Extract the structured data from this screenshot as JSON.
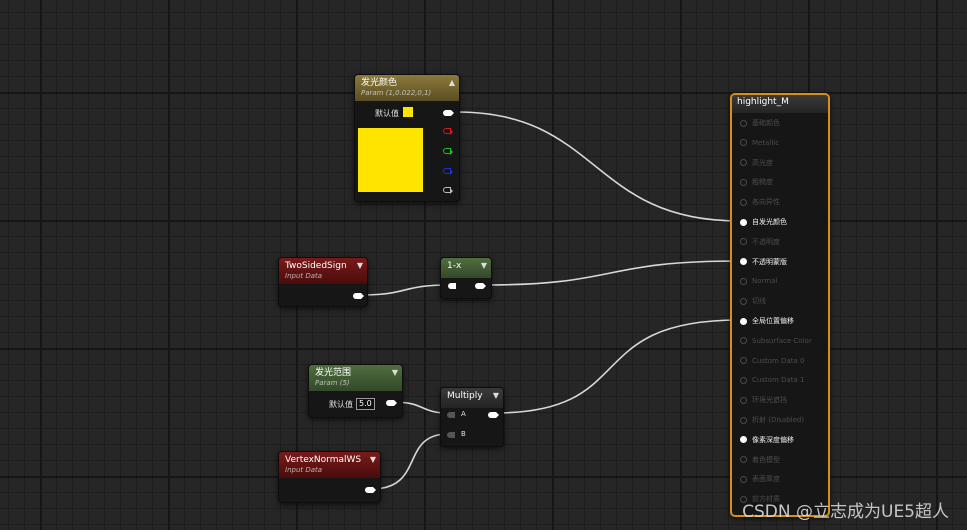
{
  "nodes": {
    "emissive_param": {
      "title": "发光颜色",
      "subtitle": "Param (1,0.022,0,1)",
      "default_label": "默认值",
      "swatch_color": "#ffe400"
    },
    "two_sided_sign": {
      "title": "TwoSidedSign",
      "subtitle": "Input Data"
    },
    "one_minus": {
      "title": "1-x"
    },
    "range_param": {
      "title": "发光范围",
      "subtitle": "Param (5)",
      "default_label": "默认值",
      "default_value": "5.0"
    },
    "multiply": {
      "title": "Multiply",
      "pin_a": "A",
      "pin_b": "B"
    },
    "vertex_normal": {
      "title": "VertexNormalWS",
      "subtitle": "Input Data"
    },
    "result": {
      "title": "highlight_M",
      "pins": [
        {
          "label": "基础颜色",
          "active": false
        },
        {
          "label": "Metallic",
          "active": false
        },
        {
          "label": "高光度",
          "active": false
        },
        {
          "label": "粗糙度",
          "active": false
        },
        {
          "label": "各向异性",
          "active": false
        },
        {
          "label": "自发光颜色",
          "active": true
        },
        {
          "label": "不透明度",
          "active": false
        },
        {
          "label": "不透明蒙版",
          "active": true
        },
        {
          "label": "Normal",
          "active": false
        },
        {
          "label": "切线",
          "active": false
        },
        {
          "label": "全局位置偏移",
          "active": true
        },
        {
          "label": "Subsurface Color",
          "active": false
        },
        {
          "label": "Custom Data 0",
          "active": false
        },
        {
          "label": "Custom Data 1",
          "active": false
        },
        {
          "label": "环境光遮挡",
          "active": false
        },
        {
          "label": "折射 (Disabled)",
          "active": false
        },
        {
          "label": "像素深度偏移",
          "active": true
        },
        {
          "label": "着色模型",
          "active": false
        },
        {
          "label": "表面厚度",
          "active": false
        },
        {
          "label": "前方材质",
          "active": false
        }
      ]
    }
  },
  "colors": {
    "wire": "#d8d8d8",
    "pin_red": "#d81818",
    "pin_green": "#22c222",
    "pin_blue": "#2030d8",
    "result_border": "#d69018"
  },
  "watermark": "CSDN @立志成为UE5超人"
}
